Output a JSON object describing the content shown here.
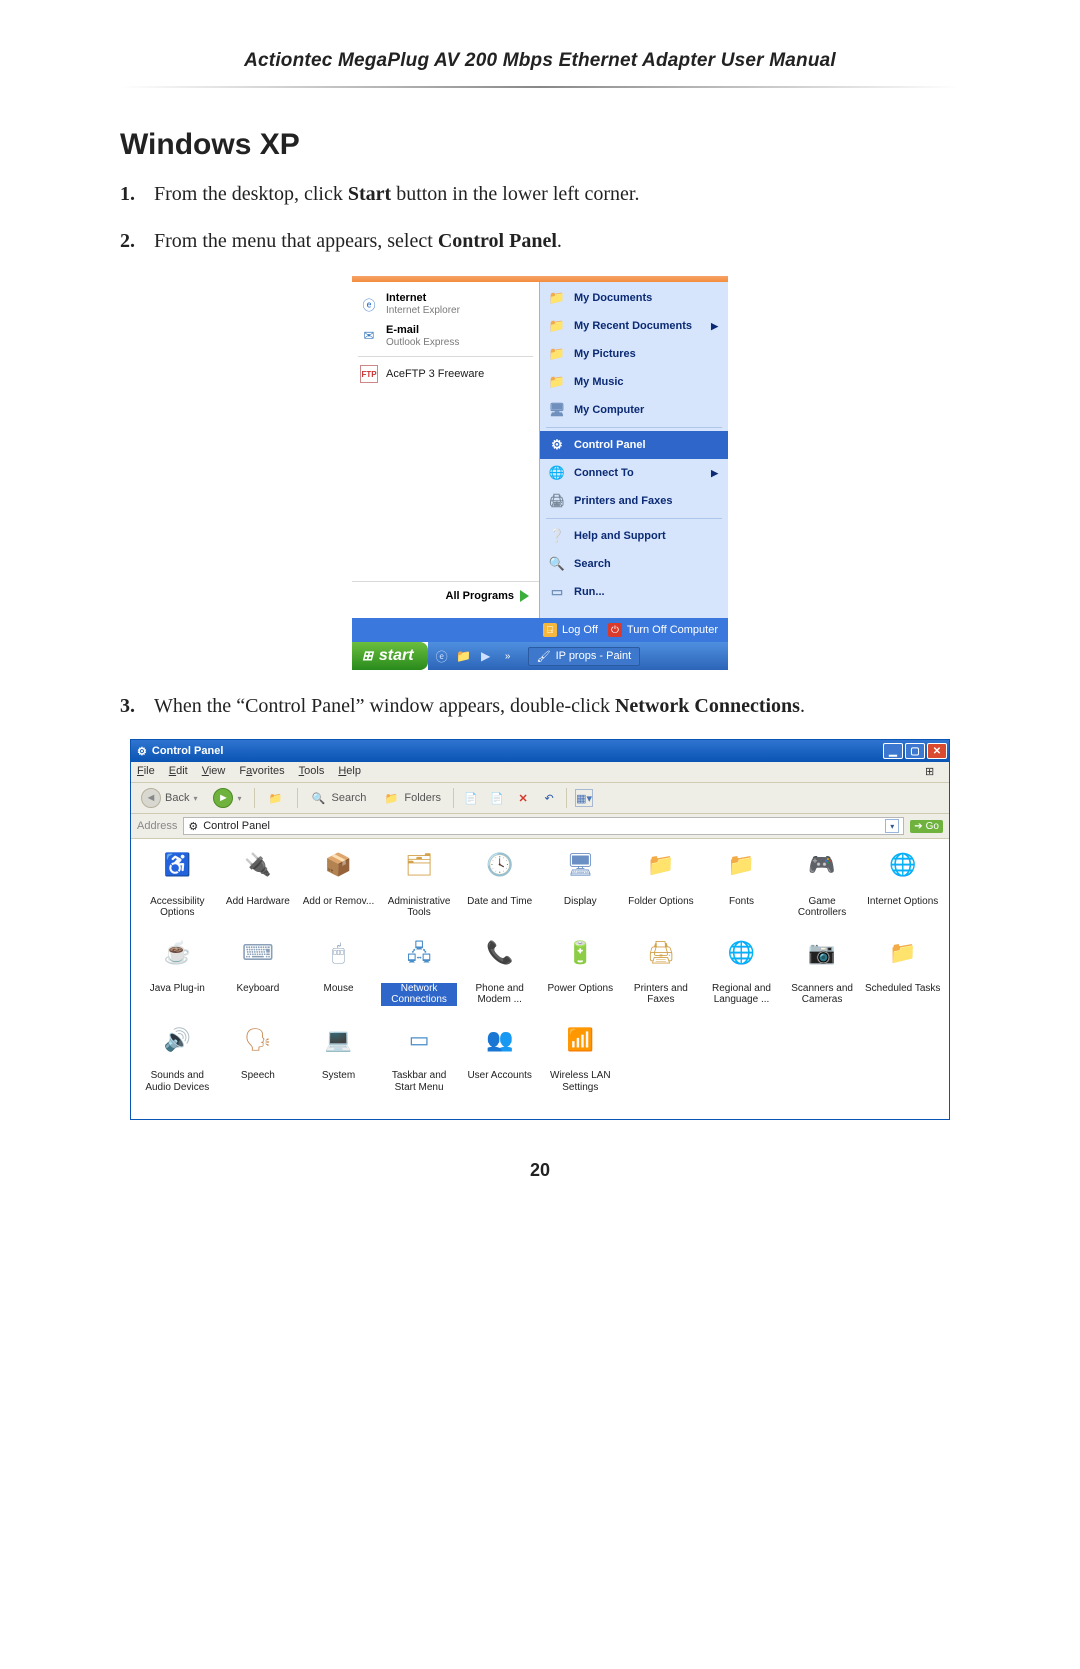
{
  "header_title": "Actiontec MegaPlug AV 200 Mbps Ethernet Adapter User Manual",
  "section_title": "Windows XP",
  "steps": {
    "1": {
      "num": "1.",
      "pre": "From the desktop, click ",
      "bold": "Start",
      "post": " button in the lower left corner."
    },
    "2": {
      "num": "2.",
      "pre": "From the menu that appears, select ",
      "bold": "Control Panel",
      "post": "."
    },
    "3": {
      "num": "3.",
      "pre": "When the “Control Panel” window appears, double-click ",
      "bold": "Network Connections",
      "post": "."
    }
  },
  "page_number": "20",
  "startmenu": {
    "left": {
      "internet": {
        "title": "Internet",
        "sub": "Internet Explorer"
      },
      "email": {
        "title": "E-mail",
        "sub": "Outlook Express"
      },
      "ftp": {
        "title": "AceFTP 3 Freeware",
        "icon": "FTP"
      }
    },
    "all_programs": "All Programs",
    "right": {
      "my_documents": "My Documents",
      "my_recent": "My Recent Documents",
      "my_pictures": "My Pictures",
      "my_music": "My Music",
      "my_computer": "My Computer",
      "control_panel": "Control Panel",
      "connect_to": "Connect To",
      "printers_faxes": "Printers and Faxes",
      "help_support": "Help and Support",
      "search": "Search",
      "run": "Run..."
    },
    "footer": {
      "logoff": "Log Off",
      "turnoff": "Turn Off Computer"
    },
    "taskbar": {
      "start": "start",
      "task": "IP props - Paint",
      "chev": "»"
    }
  },
  "controlpanel": {
    "title": "Control Panel",
    "menu": {
      "file": "File",
      "edit": "Edit",
      "view": "View",
      "favorites": "Favorites",
      "tools": "Tools",
      "help": "Help"
    },
    "toolbar": {
      "back": "Back",
      "search": "Search",
      "folders": "Folders"
    },
    "address": {
      "label": "Address",
      "value": "Control Panel",
      "go": "Go"
    },
    "items": [
      {
        "name": "Accessibility Options",
        "icon": "♿",
        "color": "#3da24b"
      },
      {
        "name": "Add Hardware",
        "icon": "🔌",
        "color": "#4e7ec5"
      },
      {
        "name": "Add or Remov...",
        "icon": "📦",
        "color": "#7aaed8"
      },
      {
        "name": "Administrative Tools",
        "icon": "🗂",
        "color": "#d3a24a"
      },
      {
        "name": "Date and Time",
        "icon": "🕓",
        "color": "#5d7ea8"
      },
      {
        "name": "Display",
        "icon": "🖥",
        "color": "#6a8fc4"
      },
      {
        "name": "Folder Options",
        "icon": "📁",
        "color": "#e3b24b"
      },
      {
        "name": "Fonts",
        "icon": "📁",
        "color": "#e3b24b"
      },
      {
        "name": "Game Controllers",
        "icon": "🎮",
        "color": "#7c8aa8"
      },
      {
        "name": "Internet Options",
        "icon": "🌐",
        "color": "#4a8ec9"
      },
      {
        "name": "Java Plug-in",
        "icon": "☕",
        "color": "#b96ba7"
      },
      {
        "name": "Keyboard",
        "icon": "⌨",
        "color": "#8aa0b8"
      },
      {
        "name": "Mouse",
        "icon": "🖱",
        "color": "#8aa0b8"
      },
      {
        "name": "Network Connections",
        "icon": "🖧",
        "color": "#4a8ec9",
        "selected": true
      },
      {
        "name": "Phone and Modem ...",
        "icon": "📞",
        "color": "#5c9a60"
      },
      {
        "name": "Power Options",
        "icon": "🔋",
        "color": "#5c9a60"
      },
      {
        "name": "Printers and Faxes",
        "icon": "🖨",
        "color": "#d3a24a"
      },
      {
        "name": "Regional and Language ...",
        "icon": "🌐",
        "color": "#5d7ea8"
      },
      {
        "name": "Scanners and Cameras",
        "icon": "📷",
        "color": "#d0b04c"
      },
      {
        "name": "Scheduled Tasks",
        "icon": "📁",
        "color": "#e3b24b"
      },
      {
        "name": "Sounds and Audio Devices",
        "icon": "🔊",
        "color": "#8aa0b8"
      },
      {
        "name": "Speech",
        "icon": "🗣",
        "color": "#c88b55"
      },
      {
        "name": "System",
        "icon": "💻",
        "color": "#6a8fc4"
      },
      {
        "name": "Taskbar and Start Menu",
        "icon": "▭",
        "color": "#4a8ec9"
      },
      {
        "name": "User Accounts",
        "icon": "👥",
        "color": "#c06836"
      },
      {
        "name": "Wireless LAN Settings",
        "icon": "📶",
        "color": "#6a8fc4"
      }
    ]
  }
}
